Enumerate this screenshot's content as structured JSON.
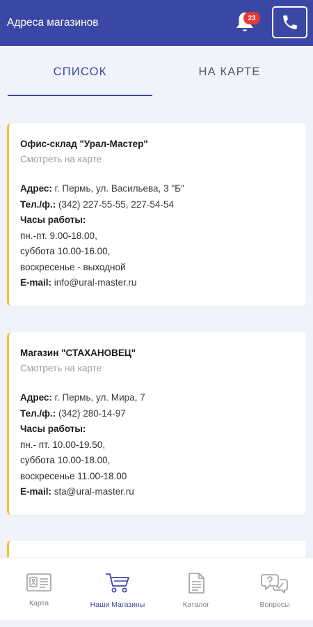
{
  "header": {
    "title": "Адреса магазинов",
    "notifications_count": "23",
    "bell_icon": "bell-icon",
    "phone_icon": "phone-icon"
  },
  "tabs": [
    {
      "label": "СПИСОК",
      "active": true
    },
    {
      "label": "НА КАРТЕ",
      "active": false
    }
  ],
  "stores": [
    {
      "name": "Офис-склад \"Урал-Мастер\"",
      "map_link": "Смотреть на карте",
      "address_label": "Адрес:",
      "address": "г. Пермь, ул. Васильева, 3 \"Б\"",
      "phone_label": "Тел./ф.:",
      "phone": "(342) 227-55-55, 227-54-54",
      "hours_label": "Часы работы:",
      "hours": [
        "пн.-пт. 9.00-18.00,",
        "суббота 10.00-16.00,",
        "воскресенье - выходной"
      ],
      "email_label": "E-mail:",
      "email": "info@ural-master.ru"
    },
    {
      "name": "Магазин \"СТАХАНОВЕЦ\"",
      "map_link": "Смотреть на карте",
      "address_label": "Адрес:",
      "address": "г. Пермь, ул. Мира, 7",
      "phone_label": "Тел./ф.:",
      "phone": "(342) 280-14-97",
      "hours_label": "Часы работы:",
      "hours": [
        "пн.- пт. 10.00-19.50,",
        "суббота 10.00-18.00,",
        "воскресенье 11.00-18.00"
      ],
      "email_label": "E-mail:",
      "email": "sta@ural-master.ru"
    }
  ],
  "bottom_nav": [
    {
      "label": "Карта",
      "icon": "map-card-icon",
      "active": false
    },
    {
      "label": "Наши Магазины",
      "icon": "cart-icon",
      "active": true
    },
    {
      "label": "Каталог",
      "icon": "document-icon",
      "active": false
    },
    {
      "label": "Вопросы",
      "icon": "question-chat-icon",
      "active": false
    }
  ],
  "colors": {
    "primary": "#3b47a5",
    "accent_border": "#f6c12d",
    "badge": "#e53935",
    "background": "#f1f3fa"
  }
}
